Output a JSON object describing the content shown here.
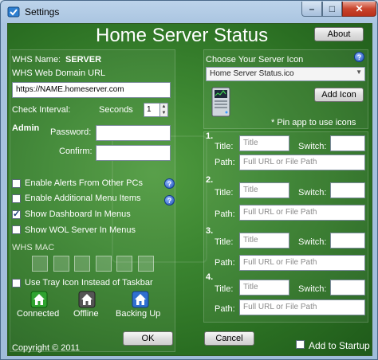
{
  "window": {
    "title": "Settings",
    "min": "–",
    "max": "□",
    "close": "✕"
  },
  "heading": "Home Server Status",
  "about_button": "About",
  "whs_name": {
    "label": "WHS Name:",
    "value": "SERVER"
  },
  "whs_url": {
    "label": "WHS Web Domain URL",
    "value": "https://NAME.homeserver.com"
  },
  "check_interval": {
    "label": "Check Interval:",
    "unit": "Seconds",
    "value": "1",
    "up": "▲",
    "down": "▼"
  },
  "admin": {
    "label": "Admin",
    "password_label": "Password:",
    "confirm_label": "Confirm:"
  },
  "options": [
    {
      "label": "Enable Alerts From Other PCs",
      "checked": false,
      "help": "?"
    },
    {
      "label": "Enable Additional Menu Items",
      "checked": false,
      "help": "?"
    },
    {
      "label": "Show Dashboard In Menus",
      "checked": true
    },
    {
      "label": "Show WOL Server In Menus",
      "checked": false
    }
  ],
  "whs_mac_label": "WHS MAC",
  "tray_icon_label": "Use Tray Icon Instead of Taskbar",
  "status_icons": [
    {
      "label": "Connected",
      "color": "#2fa32f"
    },
    {
      "label": "Offline",
      "color": "#6a6a6a"
    },
    {
      "label": "Backing Up",
      "color": "#2f6fd0"
    }
  ],
  "server_icon": {
    "label": "Choose Your Server Icon",
    "selected": "Home Server Status.ico",
    "add_button": "Add Icon",
    "pin_note": "* Pin app to use icons",
    "help": "?",
    "arrow": "▼"
  },
  "menu_items": [
    {
      "num": "1.",
      "title_label": "Title:",
      "title_ph": "Title",
      "switch_label": "Switch:",
      "path_label": "Path:",
      "path_ph": "Full URL or File Path"
    },
    {
      "num": "2.",
      "title_label": "Title:",
      "title_ph": "Title",
      "switch_label": "Switch:",
      "path_label": "Path:",
      "path_ph": "Full URL or File Path"
    },
    {
      "num": "3.",
      "title_label": "Title:",
      "title_ph": "Title",
      "switch_label": "Switch:",
      "path_label": "Path:",
      "path_ph": "Full URL or File Path"
    },
    {
      "num": "4.",
      "title_label": "Title:",
      "title_ph": "Title",
      "switch_label": "Switch:",
      "path_label": "Path:",
      "path_ph": "Full URL or File Path"
    }
  ],
  "ok_button": "OK",
  "cancel_button": "Cancel",
  "copyright": "Copyright © 2011",
  "add_to_startup": "Add to Startup"
}
